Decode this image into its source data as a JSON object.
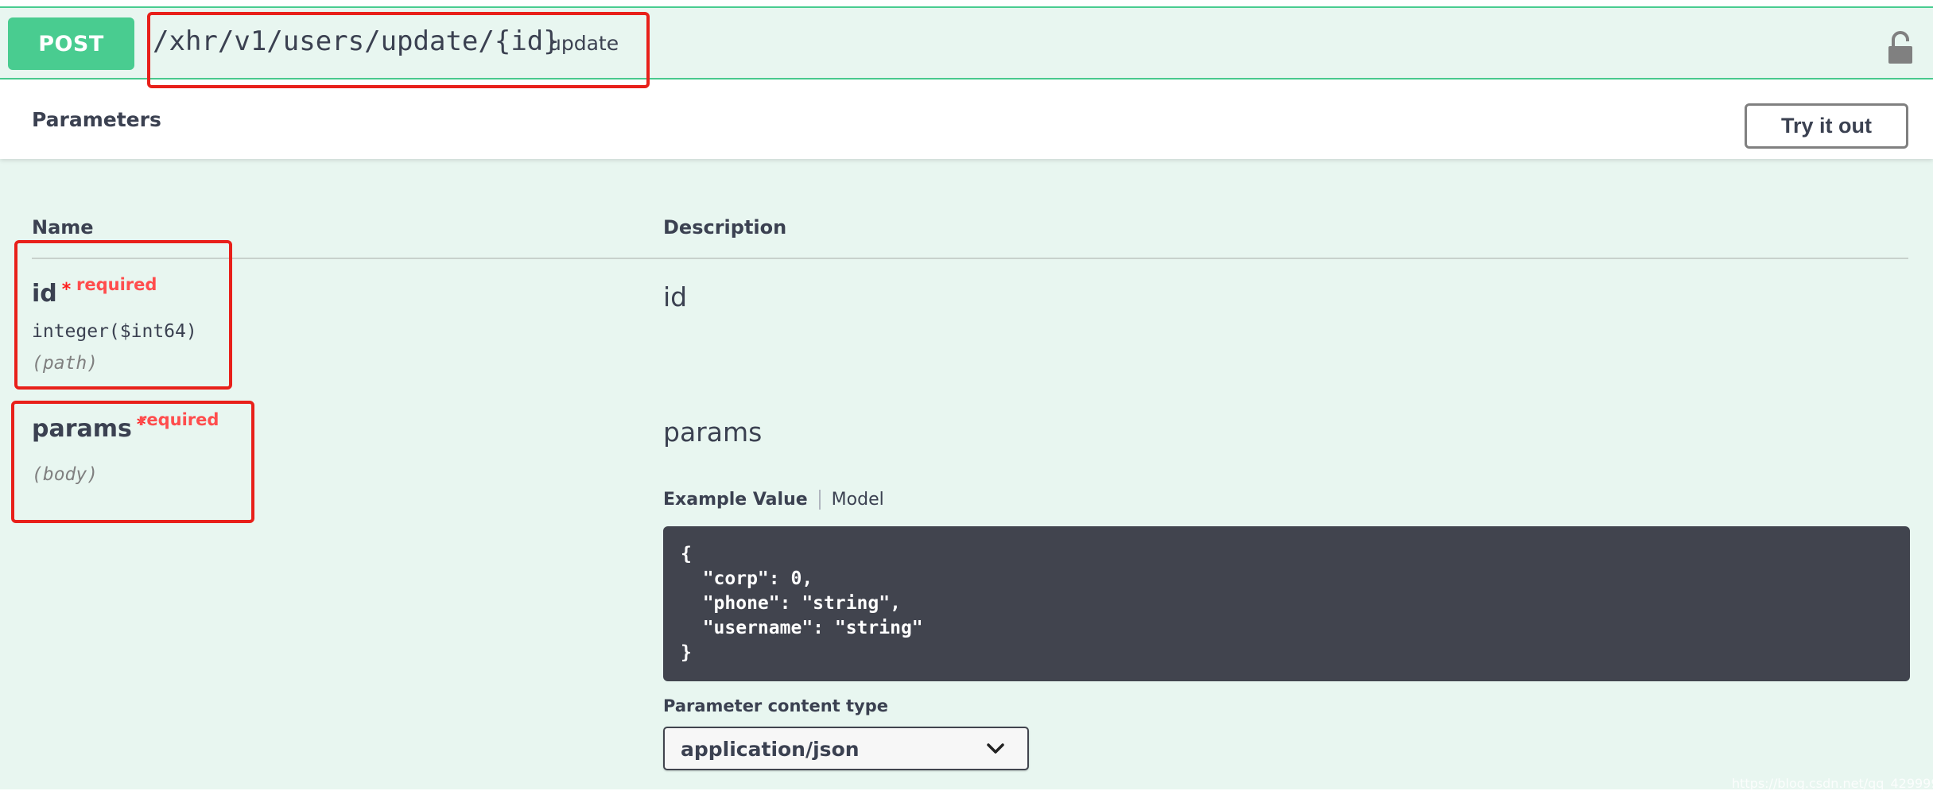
{
  "operation": {
    "method": "POST",
    "path": "/xhr/v1/users/update/{id}",
    "summary": "update"
  },
  "parameters_section": {
    "title": "Parameters",
    "try_button_label": "Try it out",
    "column_name": "Name",
    "column_description": "Description"
  },
  "params": [
    {
      "name": "id",
      "required_star": "*",
      "required_label": "required",
      "type": "integer($int64)",
      "in": "(path)",
      "description": "id"
    },
    {
      "name": "params",
      "required_star": "*",
      "required_label": "required",
      "in": "(body)",
      "description": "params",
      "tabs": {
        "example_value": "Example Value",
        "model": "Model"
      },
      "example_json": "{\n  \"corp\": 0,\n  \"phone\": \"string\",\n  \"username\": \"string\"\n}",
      "content_type_label": "Parameter content type",
      "content_type_value": "application/json"
    }
  ],
  "watermark": "https://blog.csdn.net/qq_42999940",
  "colors": {
    "post_green": "#49cc90",
    "post_background": "#e8f6f0",
    "required_red": "#ff4d4d",
    "annotation_red": "#e8201a",
    "code_background": "#41444e",
    "text_dark": "#3b4151"
  },
  "icons": {
    "lock": "lock-icon",
    "select_arrow": "chevron-down-icon"
  }
}
